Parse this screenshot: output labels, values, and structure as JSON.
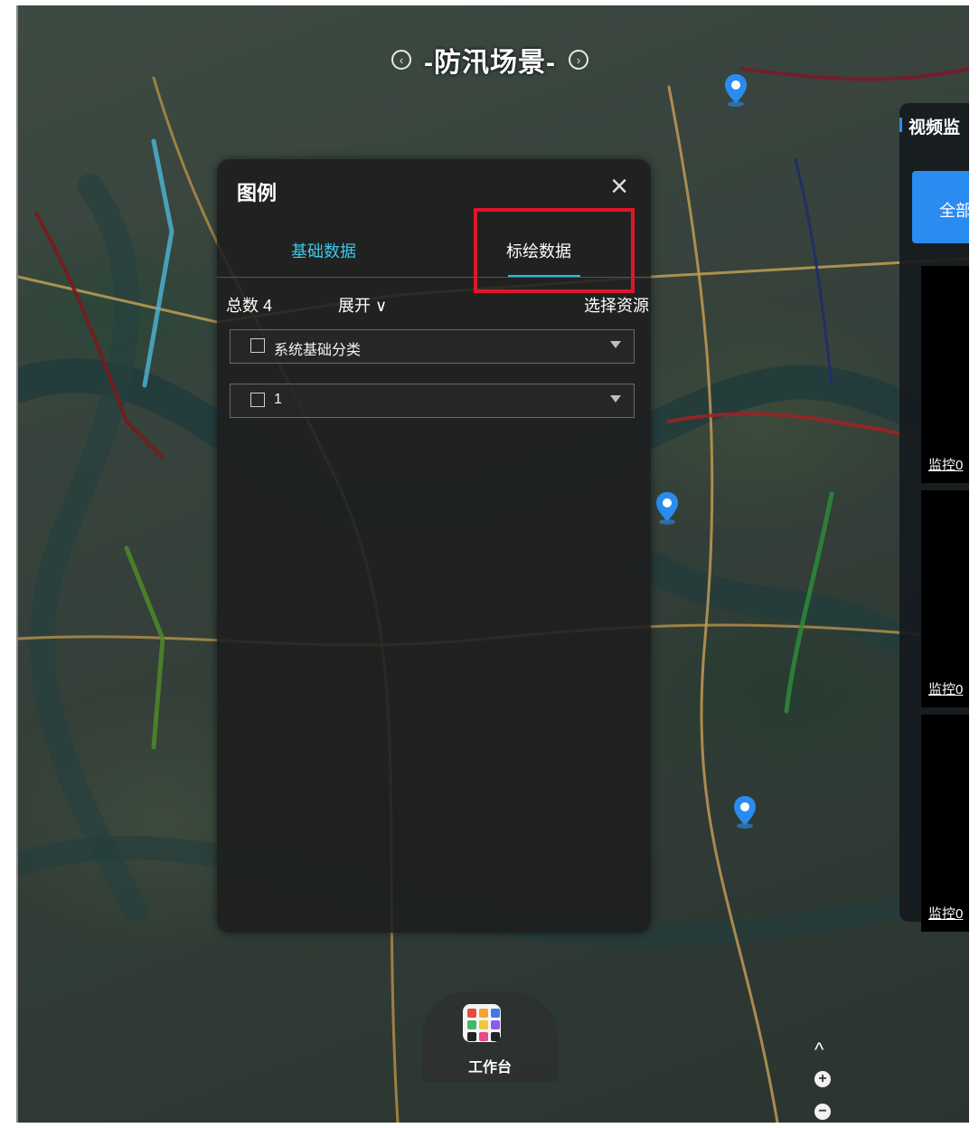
{
  "scene": {
    "title": "-防汛场景-",
    "prev_icon": "chevron-left-icon",
    "next_icon": "chevron-right-icon"
  },
  "legend": {
    "title": "图例",
    "tabs": [
      {
        "label": "基础数据",
        "active": false
      },
      {
        "label": "标绘数据",
        "active": true
      }
    ],
    "total_label": "总数 4",
    "expand_label": "展开 ∨",
    "select_label": "选择资源",
    "categories": [
      {
        "label": "系统基础分类",
        "checked": false
      },
      {
        "label": "1",
        "checked": false
      }
    ]
  },
  "video_panel": {
    "title": "视频监",
    "all_button": "全部",
    "cards": [
      {
        "label": "监控0"
      },
      {
        "label": "监控0"
      },
      {
        "label": "监控0"
      }
    ]
  },
  "workbench": {
    "label": "工作台"
  },
  "zoom": {
    "up": "^",
    "in": "+",
    "out": "−"
  },
  "colors": {
    "accent": "#2fbcd8",
    "highlight": "#e1152c",
    "primary": "#2a8cf0"
  }
}
